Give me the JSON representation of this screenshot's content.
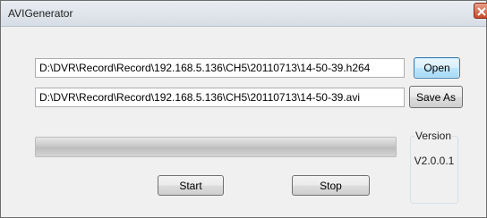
{
  "window": {
    "title": "AVIGenerator",
    "close_icon": "close-x-icon"
  },
  "source": {
    "value": "D:\\DVR\\Record\\Record\\192.168.5.136\\CH5\\20110713\\14-50-39.h264",
    "open_label": "Open"
  },
  "output": {
    "value": "D:\\DVR\\Record\\Record\\192.168.5.136\\CH5\\20110713\\14-50-39.avi",
    "save_as_label": "Save As"
  },
  "progress": {
    "value": 0
  },
  "version": {
    "label": "Version",
    "value": "V2.0.0.1"
  },
  "actions": {
    "start_label": "Start",
    "stop_label": "Stop"
  }
}
